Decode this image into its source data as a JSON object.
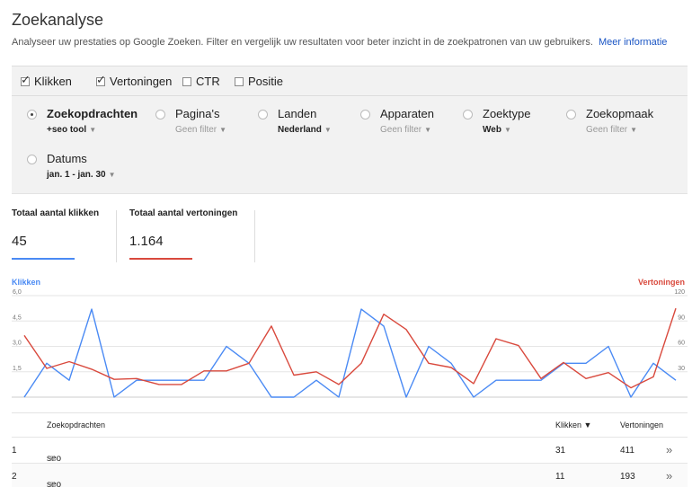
{
  "header": {
    "title": "Zoekanalyse",
    "description": "Analyseer uw prestaties op Google Zoeken. Filter en vergelijk uw resultaten voor beter inzicht in de zoekpatronen van uw gebruikers.",
    "more_link": "Meer informatie"
  },
  "metrics": [
    {
      "label": "Klikken",
      "checked": true
    },
    {
      "label": "Vertoningen",
      "checked": true
    },
    {
      "label": "CTR",
      "checked": false
    },
    {
      "label": "Positie",
      "checked": false
    }
  ],
  "check_glyph": "✓",
  "caret_glyph": "▼",
  "dimensions": [
    {
      "name": "Zoekopdrachten",
      "value": "+seo tool",
      "selected": true,
      "active": true
    },
    {
      "name": "Pagina's",
      "value": "Geen filter",
      "selected": false,
      "active": false
    },
    {
      "name": "Landen",
      "value": "Nederland",
      "selected": false,
      "active": true
    },
    {
      "name": "Apparaten",
      "value": "Geen filter",
      "selected": false,
      "active": false
    },
    {
      "name": "Zoektype",
      "value": "Web",
      "selected": false,
      "active": true
    },
    {
      "name": "Zoekopmaak",
      "value": "Geen filter",
      "selected": false,
      "active": false
    },
    {
      "name": "Datums",
      "value": "jan. 1 - jan. 30",
      "selected": false,
      "active": true
    }
  ],
  "totals": [
    {
      "label": "Totaal aantal klikken",
      "value": "45",
      "color": "#4a8af4"
    },
    {
      "label": "Totaal aantal vertoningen",
      "value": "1.164",
      "color": "#d9493d"
    }
  ],
  "chart_data": {
    "type": "line",
    "x": [
      1,
      2,
      3,
      4,
      5,
      6,
      7,
      8,
      9,
      10,
      11,
      12,
      13,
      14,
      15,
      16,
      17,
      18,
      19,
      20,
      21,
      22,
      23,
      24,
      25,
      26,
      27,
      28,
      29,
      30
    ],
    "left_axis": {
      "label": "Klikken",
      "ticks": [
        "1,5",
        "3,0",
        "4,5",
        "6,0"
      ],
      "range": [
        0,
        6
      ]
    },
    "right_axis": {
      "label": "Vertoningen",
      "ticks": [
        "30",
        "60",
        "90",
        "120"
      ],
      "range": [
        0,
        120
      ]
    },
    "series": [
      {
        "name": "Klikken",
        "axis": "left",
        "color": "#4a8af4",
        "values": [
          0,
          2,
          1,
          5.2,
          0,
          1,
          1,
          1,
          1,
          3,
          2,
          0,
          0,
          1,
          0,
          5.2,
          4.2,
          0,
          3,
          2,
          0,
          1,
          1,
          1,
          2,
          2,
          3,
          0,
          2,
          1
        ]
      },
      {
        "name": "Vertoningen",
        "axis": "right",
        "color": "#d9493d",
        "values": [
          73,
          34,
          42,
          33,
          21,
          22,
          15,
          15,
          31,
          31,
          40,
          84,
          26,
          30,
          15,
          40,
          98,
          80,
          40,
          35,
          16,
          69,
          61,
          22,
          41,
          22,
          29,
          11,
          24,
          105
        ]
      }
    ],
    "grid": true
  },
  "table": {
    "headers": {
      "query": "Zoekopdrachten",
      "clicks": "Klikken ▼",
      "impressions": "Vertoningen"
    },
    "rows": [
      {
        "rank": "1",
        "query": "seo tools",
        "clicks": "31",
        "impressions": "411"
      },
      {
        "rank": "2",
        "query": "seo tool",
        "clicks": "11",
        "impressions": "193"
      }
    ],
    "ext_glyph": "⧉",
    "chevron_glyph": "»"
  }
}
